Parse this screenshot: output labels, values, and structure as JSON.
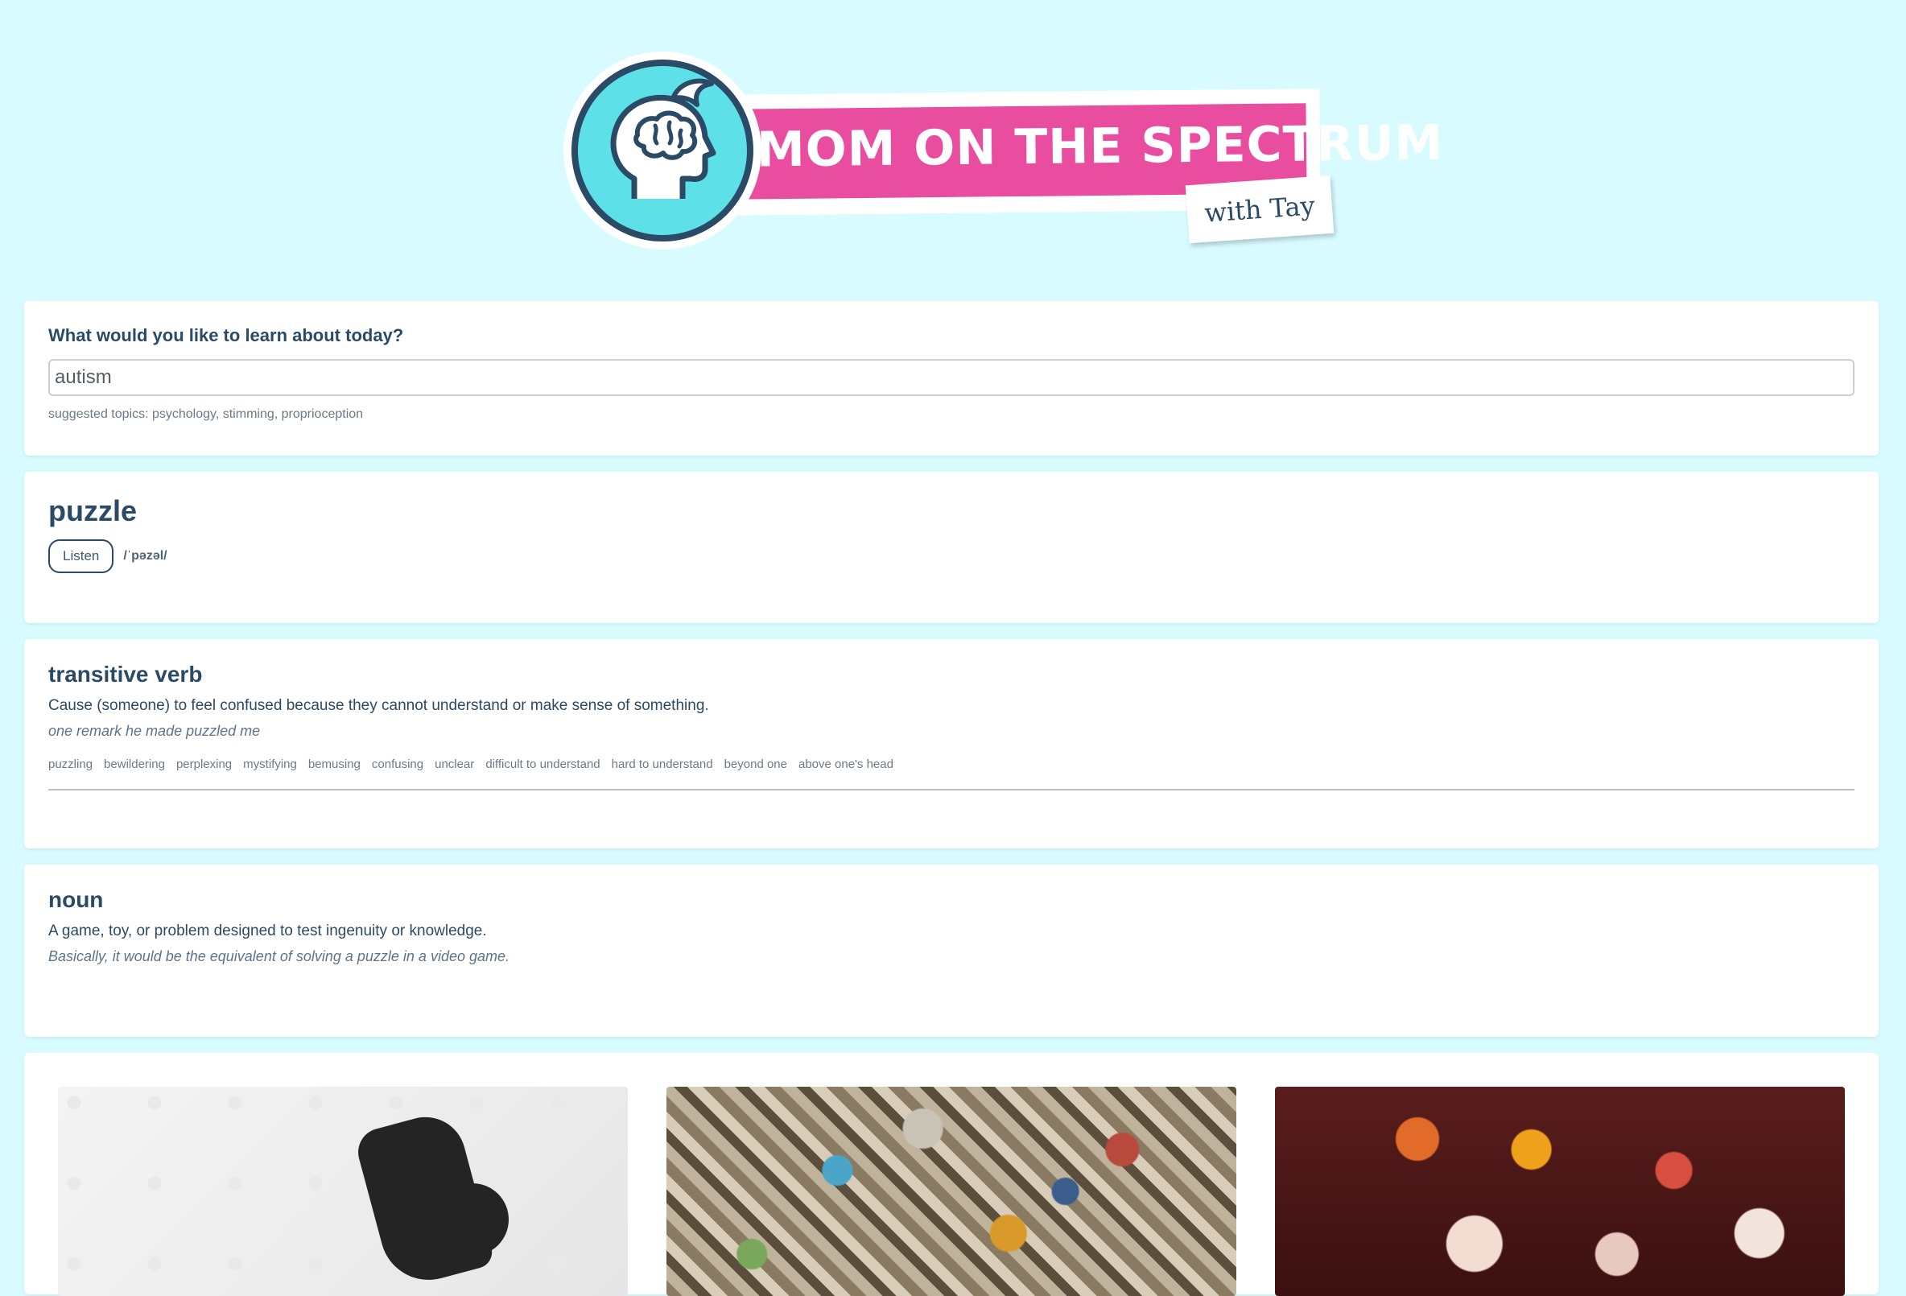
{
  "brand": {
    "title": "MOM ON THE SPECTRUM",
    "tagline": "with Tay",
    "colors": {
      "background": "#d7fbff",
      "banner": "#e84d9f",
      "circle": "#5ee0e8",
      "navy": "#2a4a66"
    },
    "logo_icon": "head-with-brain-icon"
  },
  "search": {
    "label": "What would you like to learn about today?",
    "value": "autism",
    "suggested_prefix": "suggested topics:",
    "suggested_topics": [
      "psychology",
      "stimming",
      "proprioception"
    ]
  },
  "word": {
    "title": "puzzle",
    "listen_label": "Listen",
    "phonetic": "/ˈpəzəl/"
  },
  "meanings": [
    {
      "part_of_speech": "transitive verb",
      "definition": "Cause (someone) to feel confused because they cannot understand or make sense of something.",
      "example": "one remark he made puzzled me",
      "synonyms": [
        "puzzling",
        "bewildering",
        "perplexing",
        "mystifying",
        "bemusing",
        "confusing",
        "unclear",
        "difficult to understand",
        "hard to understand",
        "beyond one",
        "above one's head"
      ]
    },
    {
      "part_of_speech": "noun",
      "definition": "A game, toy, or problem designed to test ingenuity or knowledge.",
      "example": "Basically, it would be the equivalent of solving a puzzle in a video game."
    }
  ],
  "images": [
    {
      "name": "white-puzzle-missing-piece-image"
    },
    {
      "name": "colorful-puzzle-pieces-image"
    },
    {
      "name": "puzzle-pieces-on-dark-table-image"
    }
  ]
}
